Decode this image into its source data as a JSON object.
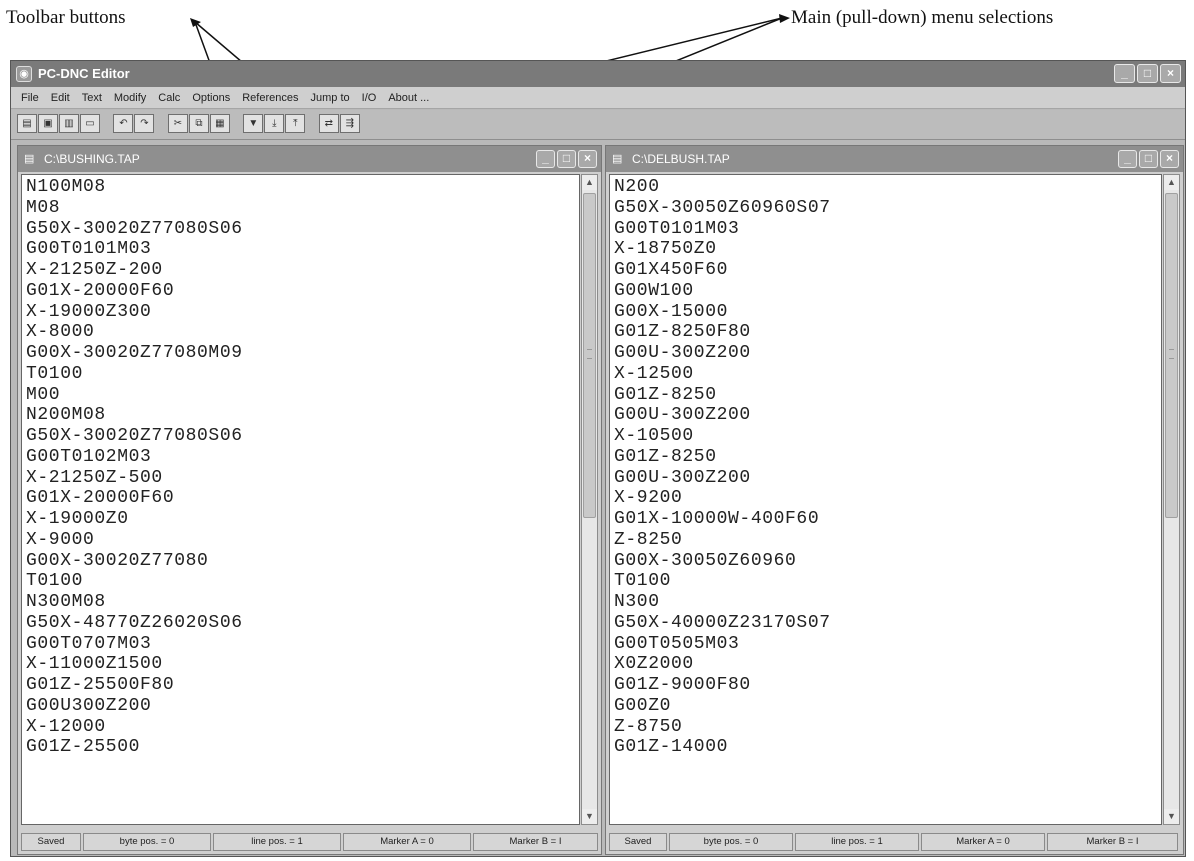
{
  "callouts": {
    "toolbar": "Toolbar  buttons",
    "menu": "Main (pull-down) menu selections"
  },
  "app": {
    "title": "PC-DNC Editor",
    "menu": [
      "File",
      "Edit",
      "Text",
      "Modify",
      "Calc",
      "Options",
      "References",
      "Jump to",
      "I/O",
      "About ..."
    ],
    "toolbar_icons": [
      [
        "open-file-icon",
        "save-icon",
        "print-icon",
        "window-icon"
      ],
      [
        "undo-icon",
        "redo-icon"
      ],
      [
        "cut-icon",
        "copy-icon",
        "paste-icon"
      ],
      [
        "filter-icon",
        "download-icon",
        "upload-icon"
      ],
      [
        "compare-icon",
        "split-icon"
      ]
    ]
  },
  "editors": [
    {
      "title": "C:\\BUSHING.TAP",
      "lines": [
        "N100M08",
        "M08",
        "G50X-30020Z77080S06",
        "G00T0101M03",
        "X-21250Z-200",
        "G01X-20000F60",
        "X-19000Z300",
        "X-8000",
        "G00X-30020Z77080M09",
        "T0100",
        "M00",
        "N200M08",
        "G50X-30020Z77080S06",
        "G00T0102M03",
        "X-21250Z-500",
        "G01X-20000F60",
        "X-19000Z0",
        "X-9000",
        "G00X-30020Z77080",
        "T0100",
        "N300M08",
        "G50X-48770Z26020S06",
        "G00T0707M03",
        "X-11000Z1500",
        "G01Z-25500F80",
        "G00U300Z200",
        "X-12000",
        "G01Z-25500"
      ],
      "status": [
        "Saved",
        "byte pos. = 0",
        "line pos. = 1",
        "Marker A = 0",
        "Marker B = I"
      ]
    },
    {
      "title": "C:\\DELBUSH.TAP",
      "lines": [
        "N200",
        "G50X-30050Z60960S07",
        "G00T0101M03",
        "X-18750Z0",
        "G01X450F60",
        "G00W100",
        "G00X-15000",
        "G01Z-8250F80",
        "G00U-300Z200",
        "X-12500",
        "G01Z-8250",
        "G00U-300Z200",
        "X-10500",
        "G01Z-8250",
        "G00U-300Z200",
        "X-9200",
        "G01X-10000W-400F60",
        "Z-8250",
        "G00X-30050Z60960",
        "T0100",
        "N300",
        "G50X-40000Z23170S07",
        "G00T0505M03",
        "X0Z2000",
        "G01Z-9000F80",
        "G00Z0",
        "Z-8750",
        "G01Z-14000"
      ],
      "status": [
        "Saved",
        "byte pos. = 0",
        "line pos. = 1",
        "Marker A = 0",
        "Marker B = I"
      ]
    }
  ],
  "icons": {
    "app": "app-icon",
    "document": "document-icon",
    "minimize": "minimize-icon",
    "maximize": "maximize-icon",
    "close": "close-icon",
    "scroll_up": "scroll-up-icon",
    "scroll_down": "scroll-down-icon"
  }
}
